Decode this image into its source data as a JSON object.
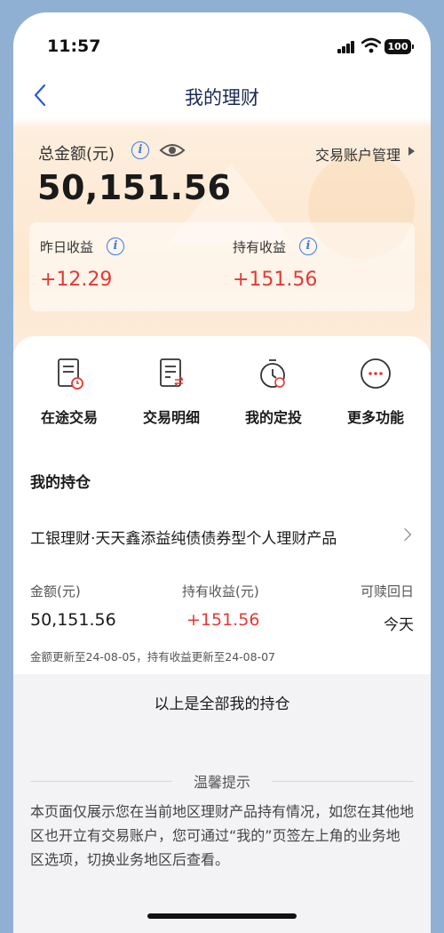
{
  "status_bar": {
    "time": "11:57",
    "battery": "100"
  },
  "nav": {
    "title": "我的理财"
  },
  "summary": {
    "total_label": "总金额(元)",
    "total_value": "50,151.56",
    "account_mgmt": "交易账户管理",
    "yesterday_label": "昨日收益",
    "yesterday_value": "+12.29",
    "holding_label": "持有收益",
    "holding_value": "+151.56"
  },
  "functions": [
    {
      "label": "在途交易",
      "icon": "document-clock-icon"
    },
    {
      "label": "交易明细",
      "icon": "document-list-icon"
    },
    {
      "label": "我的定投",
      "icon": "timer-icon"
    },
    {
      "label": "更多功能",
      "icon": "more-icon"
    }
  ],
  "holdings": {
    "title": "我的持仓",
    "product_name": "工银理财·天天鑫添益纯债债券型个人理财产品",
    "amount_label": "金额(元)",
    "amount_value": "50,151.56",
    "profit_label": "持有收益(元)",
    "profit_value": "+151.56",
    "redeem_label": "可赎回日",
    "redeem_value": "今天",
    "update_note": "金额更新至24-08-05，持有收益更新至24-08-07"
  },
  "footer": {
    "end_text": "以上是全部我的持仓",
    "tip_title": "温馨提示",
    "tip_text": "本页面仅展示您在当前地区理财产品持有情况，如您在其他地区也开立有交易账户，您可通过“我的”页签左上角的业务地区选项，切换业务地区后查看。"
  },
  "colors": {
    "accent": "#3b7be8",
    "profit": "#e53935",
    "title": "#1b2a55",
    "page_bg": "#8fb0d2"
  }
}
